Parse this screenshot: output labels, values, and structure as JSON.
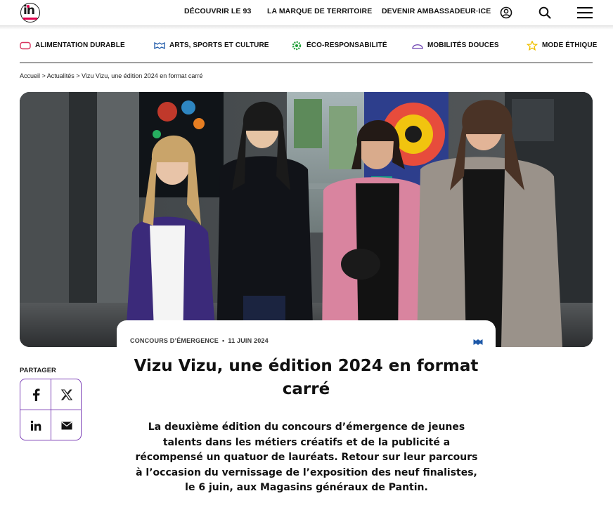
{
  "header": {
    "logo_text": "in",
    "nav": [
      "DÉCOUVRIR LE 93",
      "LA MARQUE DE TERRITOIRE",
      "DEVENIR AMBASSADEUR·ICE"
    ],
    "icons": [
      "account-icon",
      "search-icon",
      "menu-icon"
    ]
  },
  "categories": [
    {
      "label": "ALIMENTATION DURABLE",
      "icon": "food-icon",
      "color": "#d8345f"
    },
    {
      "label": "ARTS, SPORTS ET CULTURE",
      "icon": "culture-icon",
      "color": "#1d58a8"
    },
    {
      "label": "ÉCO-RESPONSABILITÉ",
      "icon": "eco-icon",
      "color": "#21a038"
    },
    {
      "label": "MOBILITÉS DOUCES",
      "icon": "mobility-icon",
      "color": "#6a3fb0"
    },
    {
      "label": "MODE ÉTHIQUE",
      "icon": "star-icon",
      "color": "#f0c000"
    }
  ],
  "breadcrumb": "Accueil > Actualités > Vizu Vizu, une édition 2024 en format carré",
  "article": {
    "category": "CONCOURS D’ÉMERGENCE",
    "separator": "•",
    "date": "11 JUIN 2024",
    "title": "Vizu Vizu, une édition 2024 en format carré",
    "lead": "La deuxième édition du concours d’émergence de jeunes talents dans les métiers créatifs et de la publicité a récompensé un quatuor de lauréats. Retour sur leur parcours à l’occasion du vernissage de l’exposition des neuf finalistes, le 6 juin, aux Magasins généraux de Pantin."
  },
  "share": {
    "label": "PARTAGER",
    "buttons": [
      "facebook-icon",
      "x-icon",
      "linkedin-icon",
      "email-icon"
    ]
  },
  "colors": {
    "accent": "#7b3fb6",
    "logo_accent": "#e0004d"
  }
}
